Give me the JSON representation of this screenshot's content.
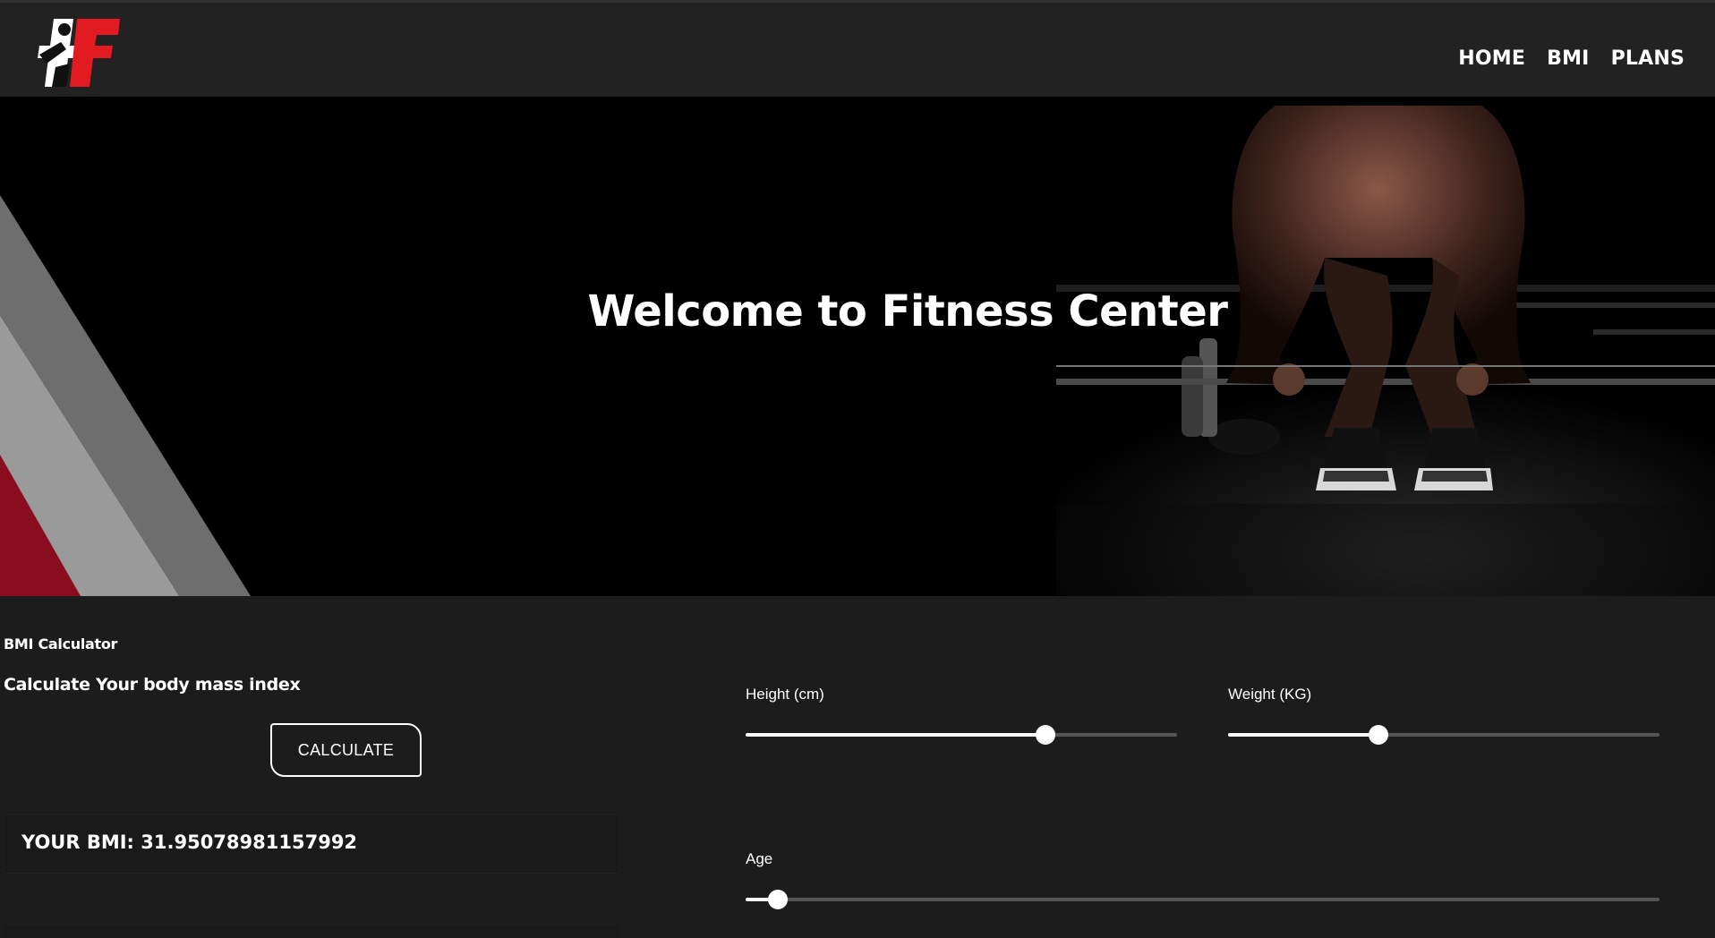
{
  "nav": {
    "logo_alt": "AF",
    "links": [
      "HOME",
      "BMI",
      "PLANS"
    ]
  },
  "hero": {
    "title": "Welcome to Fitness Center"
  },
  "bmi": {
    "label": "BMI Calculator",
    "subtitle": "Calculate Your body mass index",
    "button": "CALCULATE",
    "result": "YOUR BMI: 31.95078981157992"
  },
  "sliders": {
    "height": {
      "label": "Height (cm)",
      "fraction": 0.695
    },
    "weight": {
      "label": "Weight (KG)",
      "fraction": 0.348
    },
    "age": {
      "label": "Age",
      "fraction": 0.035
    }
  },
  "colors": {
    "navbar": "#222222",
    "page": "#1c1c1c",
    "accent_red": "#e21b23",
    "dark_red": "#7a0a17"
  }
}
